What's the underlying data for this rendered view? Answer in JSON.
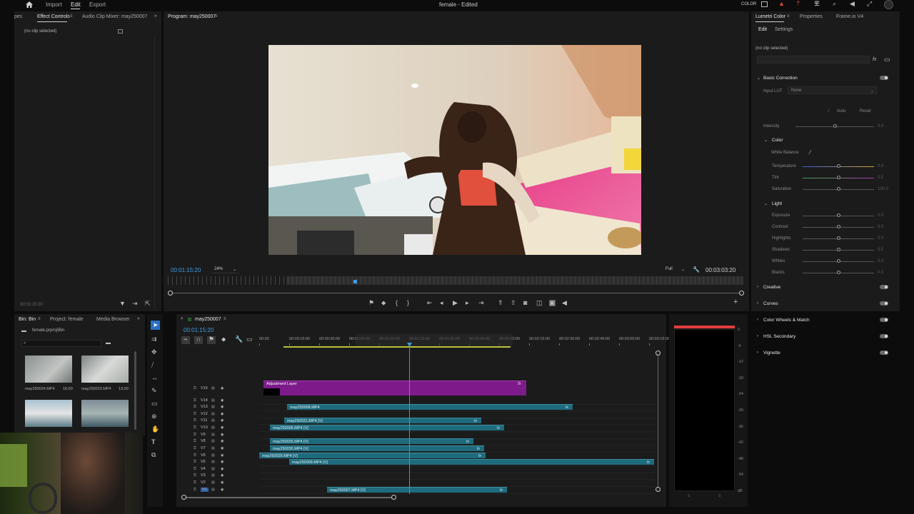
{
  "menu": {
    "items": [
      "Import",
      "Edit",
      "Export"
    ],
    "active": "Edit",
    "doc_title": "female - Edited",
    "workspace": "COLOR"
  },
  "source_panel": {
    "tabs": [
      "pes",
      "Effect Controls",
      "Audio Clip Mixer: may250007"
    ],
    "no_clip": "(no clip selected)",
    "timecode": "00:01:15:20"
  },
  "program": {
    "tab": "Program: may250007",
    "timecode": "00:01:15:20",
    "zoom": "24%",
    "resolution": "Full",
    "duration": "00:03:03:20"
  },
  "lumetri": {
    "tabs": [
      "Lumetri Color",
      "Properties",
      "Frame.io V4"
    ],
    "subtabs": [
      "Edit",
      "Settings"
    ],
    "no_clip": "(no clip selected)",
    "basic_correction": "Basic Correction",
    "input_lut_label": "Input LUT",
    "input_lut_value": "None",
    "auto": "Auto",
    "reset": "Reset",
    "intensity": "Intensity",
    "intensity_val": "0.0",
    "color": "Color",
    "white_balance": "White Balance",
    "color_sliders": [
      {
        "label": "Temperature",
        "value": "0.0"
      },
      {
        "label": "Tint",
        "value": "0.0"
      },
      {
        "label": "Saturation",
        "value": "100.0"
      }
    ],
    "light": "Light",
    "light_sliders": [
      {
        "label": "Exposure",
        "value": "0.0"
      },
      {
        "label": "Contrast",
        "value": "0.0"
      },
      {
        "label": "Highlights",
        "value": "0.0"
      },
      {
        "label": "Shadows",
        "value": "0.0"
      },
      {
        "label": "Whites",
        "value": "0.0"
      },
      {
        "label": "Blacks",
        "value": "0.0"
      }
    ],
    "sections": [
      "Creative",
      "Curves",
      "Color Wheels & Match",
      "HSL Secondary",
      "Vignette"
    ]
  },
  "project": {
    "tabs": [
      "Bin: Bin",
      "Project: female",
      "Media Browser"
    ],
    "path": "female.prproj\\Bin",
    "items": [
      {
        "name": "may250024.MP4",
        "duration": "16;00"
      },
      {
        "name": "may250023.MP4",
        "duration": "13;00"
      }
    ]
  },
  "timeline": {
    "tab": "may250007",
    "timecode": "00:01:15:20",
    "ruler": [
      "00:00",
      "00:00:15:00",
      "00:00:30:00",
      "00:00:45:00",
      "00:01:00:00",
      "00:01:15:00",
      "00:01:30:00",
      "00:01:45:00",
      "00:02:00:00",
      "00:02:15:00",
      "00:02:30:00",
      "00:02:45:00",
      "00:03:00:00",
      "00:03:15:00"
    ],
    "tracks": [
      "V15",
      "V14",
      "V13",
      "V12",
      "V11",
      "V10",
      "V9",
      "V8",
      "V7",
      "V6",
      "V5",
      "V4",
      "V3",
      "V2",
      "V1"
    ],
    "adjustment_layer": "Adjustment Layer",
    "clips": [
      {
        "name": "may250008.MP4"
      },
      {
        "name": "may250031.MP4 [V]"
      },
      {
        "name": "may250006.MP4 [V]"
      },
      {
        "name": "may250025.MP4 [V]"
      },
      {
        "name": "may250030.MP4 [V]"
      },
      {
        "name": "may250029.MP4 [V]"
      },
      {
        "name": "may250009.MP4 [V]"
      },
      {
        "name": "may250007.MP4 [V]"
      }
    ]
  },
  "meter": {
    "scale": [
      "0",
      "-6",
      "-12",
      "-18",
      "-24",
      "-30",
      "-36",
      "-42",
      "-48",
      "-54",
      "dB"
    ],
    "channels": [
      "S",
      "S"
    ]
  },
  "colors": {
    "accent": "#2d8ceb",
    "clip": "#1f6b7e",
    "adjustment": "#7d1b8a",
    "playhead": "#3a9ad9"
  }
}
